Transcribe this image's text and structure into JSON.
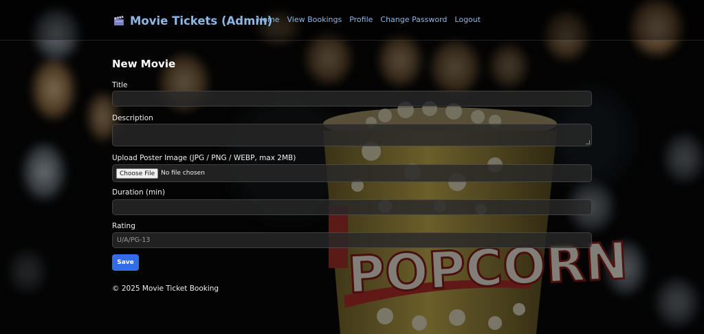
{
  "brand": {
    "title": "Movie Tickets (Admin)",
    "icon": "clapperboard-icon"
  },
  "nav": {
    "items": [
      {
        "label": "Home"
      },
      {
        "label": "View Bookings"
      },
      {
        "label": "Profile"
      },
      {
        "label": "Change Password"
      },
      {
        "label": "Logout"
      }
    ]
  },
  "form": {
    "heading": "New Movie",
    "title_label": "Title",
    "title_value": "",
    "description_label": "Description",
    "description_value": "",
    "poster_label": "Upload Poster Image (JPG / PNG / WEBP, max 2MB)",
    "choose_file_label": "Choose File",
    "file_status": "No file chosen",
    "duration_label": "Duration (min)",
    "duration_value": "",
    "rating_label": "Rating",
    "rating_placeholder": "U/A/PG-13",
    "save_label": "Save"
  },
  "footer": {
    "text": "© 2025 Movie Ticket Booking"
  },
  "background": {
    "popcorn_text": "POPCORN"
  },
  "colors": {
    "link": "#8db8e6",
    "primary_button": "#2f6ee6",
    "field_bg": "#282828",
    "page_bg": "#050505"
  }
}
